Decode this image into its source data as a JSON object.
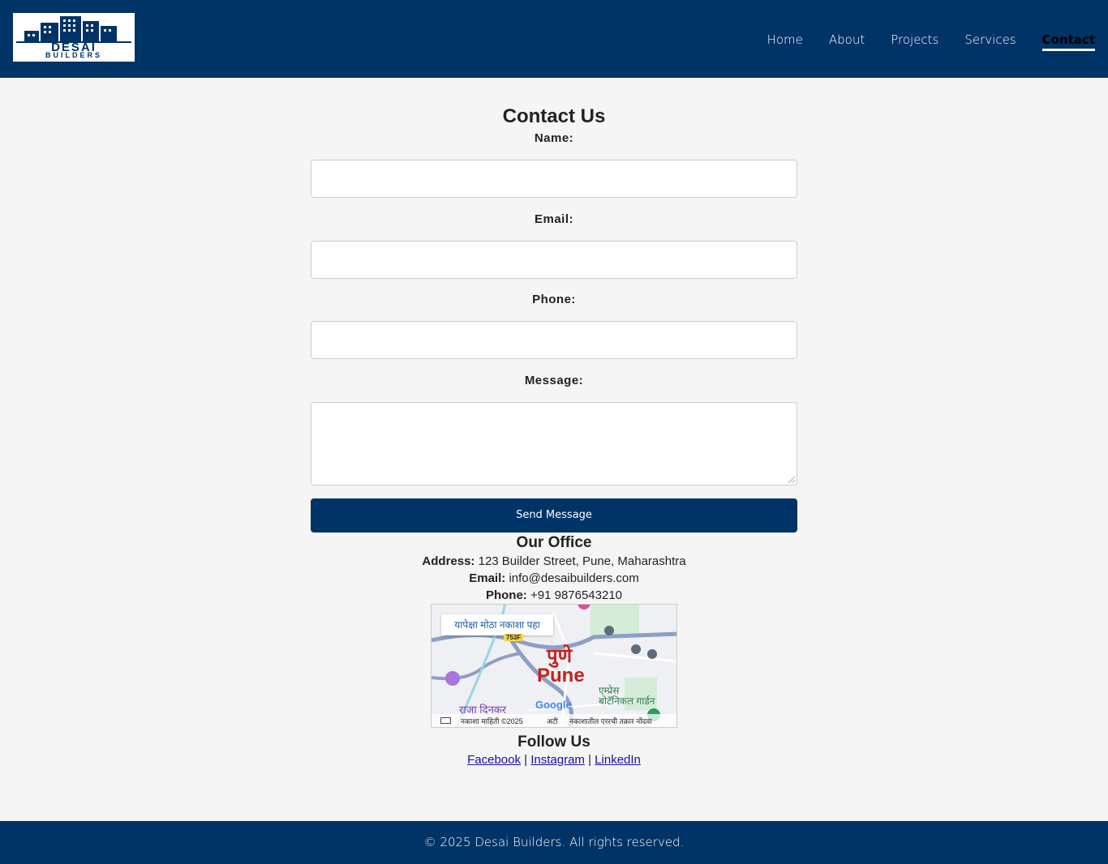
{
  "logo": {
    "line1": "DESAI",
    "line2": "BUILDERS"
  },
  "nav": {
    "items": [
      {
        "label": "Home"
      },
      {
        "label": "About"
      },
      {
        "label": "Projects"
      },
      {
        "label": "Services"
      },
      {
        "label": "Contact",
        "active": true
      }
    ]
  },
  "contact": {
    "title": "Contact Us",
    "name_label": "Name:",
    "email_label": "Email:",
    "phone_label": "Phone:",
    "message_label": "Message:",
    "send_label": "Send Message"
  },
  "office": {
    "title": "Our Office",
    "address_label": "Address:",
    "address": "123 Builder Street, Pune, Maharashtra",
    "email_label": "Email:",
    "email": "info@desaibuilders.com",
    "phone_label": "Phone:",
    "phone": "+91 9876543210"
  },
  "map": {
    "view_larger": "यापेक्षा मोठा नकाशा पहा",
    "road_label": "753F",
    "city_local": "पुणे",
    "city": "Pune",
    "place_1": "राजा दिनकर",
    "place_2": "एम्प्रेस बोटॅनिकल गार्डन",
    "google": "Google",
    "data_text": "नकाशा माहिती ©2025",
    "terms": "अटी",
    "report": "नकाशातील एररची तक्रार नोंदवा"
  },
  "follow": {
    "title": "Follow Us",
    "facebook": "Facebook",
    "instagram": "Instagram",
    "linkedin": "LinkedIn",
    "separator": "|"
  },
  "footer": {
    "text": "© 2025 Desai Builders. All rights reserved."
  },
  "colors": {
    "brand": "#003366",
    "background": "#f5f5f5",
    "link": "#1a0dab"
  }
}
